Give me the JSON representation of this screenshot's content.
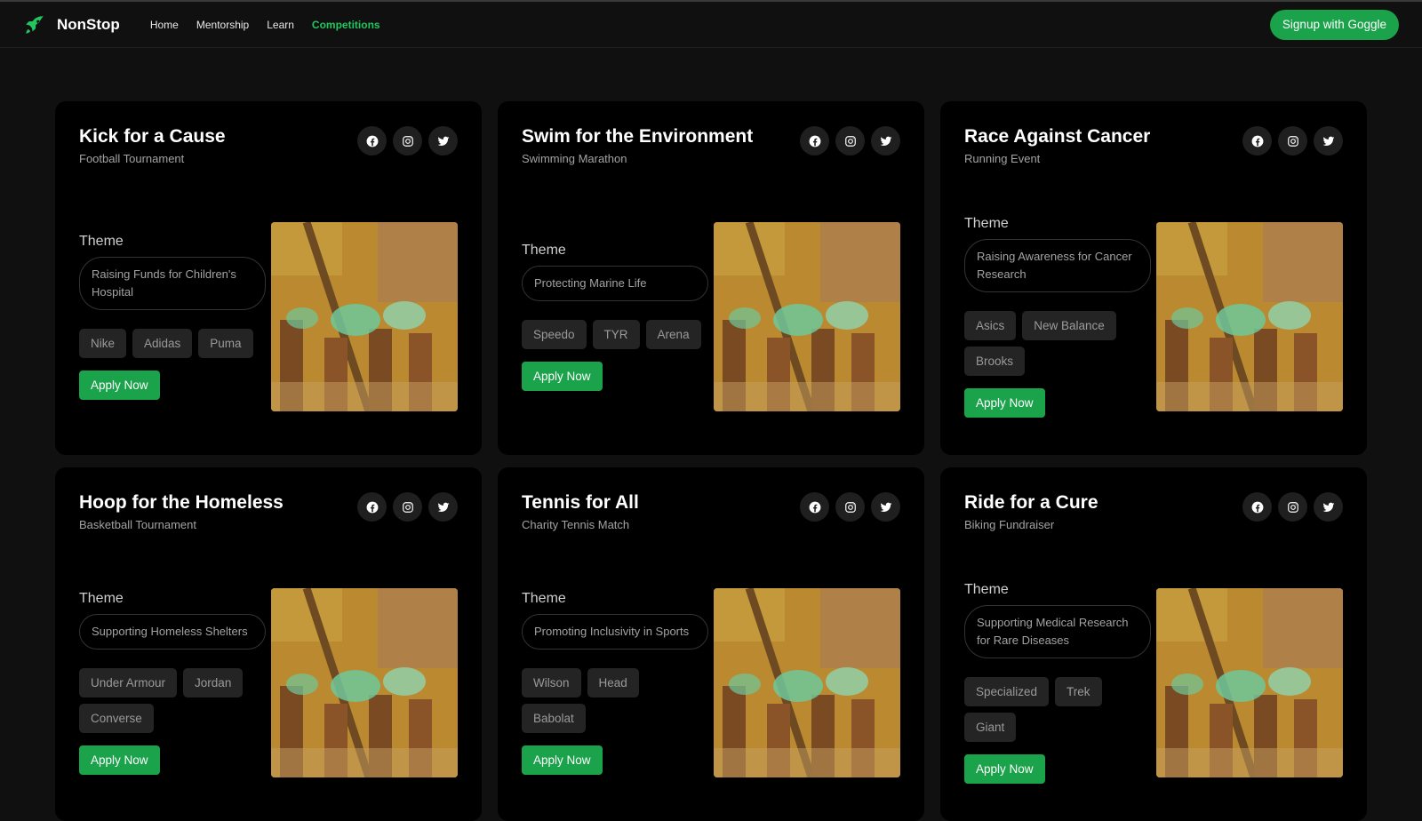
{
  "nav": {
    "brand": "NonStop",
    "links": [
      "Home",
      "Mentorship",
      "Learn",
      "Competitions"
    ],
    "active_index": 3,
    "signup_label": "Signup with Goggle"
  },
  "theme_label": "Theme",
  "apply_label": "Apply Now",
  "cards": [
    {
      "title": "Kick for a Cause",
      "subtitle": "Football Tournament",
      "theme": "Raising Funds for Children's Hospital",
      "sponsors": [
        "Nike",
        "Adidas",
        "Puma"
      ]
    },
    {
      "title": "Swim for the Environment",
      "subtitle": "Swimming Marathon",
      "theme": "Protecting Marine Life",
      "sponsors": [
        "Speedo",
        "TYR",
        "Arena"
      ]
    },
    {
      "title": "Race Against Cancer",
      "subtitle": "Running Event",
      "theme": "Raising Awareness for Cancer Research",
      "sponsors": [
        "Asics",
        "New Balance",
        "Brooks"
      ]
    },
    {
      "title": "Hoop for the Homeless",
      "subtitle": "Basketball Tournament",
      "theme": "Supporting Homeless Shelters",
      "sponsors": [
        "Under Armour",
        "Jordan",
        "Converse"
      ]
    },
    {
      "title": "Tennis for All",
      "subtitle": "Charity Tennis Match",
      "theme": "Promoting Inclusivity in Sports",
      "sponsors": [
        "Wilson",
        "Head",
        "Babolat"
      ]
    },
    {
      "title": "Ride for a Cure",
      "subtitle": "Biking Fundraiser",
      "theme": "Supporting Medical Research for Rare Diseases",
      "sponsors": [
        "Specialized",
        "Trek",
        "Giant"
      ]
    }
  ],
  "colors": {
    "accent": "#1aa34a",
    "active_link": "#22c55e",
    "background": "#101010",
    "card": "#000000"
  },
  "icons": [
    "rocket-icon",
    "facebook-icon",
    "instagram-icon",
    "twitter-icon"
  ]
}
